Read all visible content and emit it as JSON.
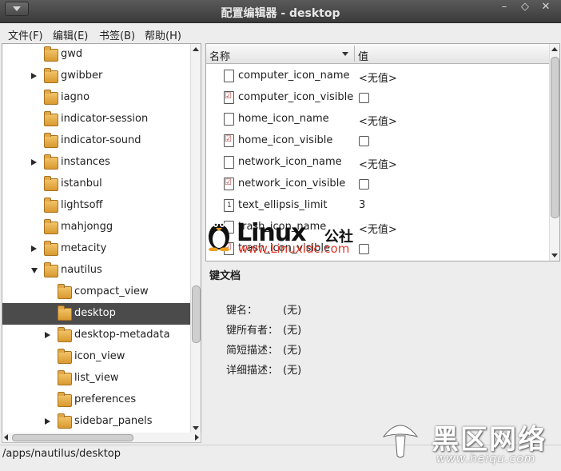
{
  "window": {
    "title": "配置编辑器 - desktop",
    "controls": [
      "–",
      "◇",
      "✕"
    ]
  },
  "menubar": [
    "文件(F)",
    "编辑(E)",
    "书签(B)",
    "帮助(H)"
  ],
  "tree": [
    {
      "label": "gwd",
      "depth": 0,
      "expander": "none",
      "selected": false
    },
    {
      "label": "gwibber",
      "depth": 0,
      "expander": "collapsed",
      "selected": false
    },
    {
      "label": "iagno",
      "depth": 0,
      "expander": "none",
      "selected": false
    },
    {
      "label": "indicator-session",
      "depth": 0,
      "expander": "none",
      "selected": false
    },
    {
      "label": "indicator-sound",
      "depth": 0,
      "expander": "none",
      "selected": false
    },
    {
      "label": "instances",
      "depth": 0,
      "expander": "collapsed",
      "selected": false
    },
    {
      "label": "istanbul",
      "depth": 0,
      "expander": "none",
      "selected": false
    },
    {
      "label": "lightsoff",
      "depth": 0,
      "expander": "none",
      "selected": false
    },
    {
      "label": "mahjongg",
      "depth": 0,
      "expander": "none",
      "selected": false
    },
    {
      "label": "metacity",
      "depth": 0,
      "expander": "collapsed",
      "selected": false
    },
    {
      "label": "nautilus",
      "depth": 0,
      "expander": "expanded",
      "selected": false
    },
    {
      "label": "compact_view",
      "depth": 1,
      "expander": "none",
      "selected": false
    },
    {
      "label": "desktop",
      "depth": 1,
      "expander": "none",
      "selected": true
    },
    {
      "label": "desktop-metadata",
      "depth": 1,
      "expander": "collapsed",
      "selected": false
    },
    {
      "label": "icon_view",
      "depth": 1,
      "expander": "none",
      "selected": false
    },
    {
      "label": "list_view",
      "depth": 1,
      "expander": "none",
      "selected": false
    },
    {
      "label": "preferences",
      "depth": 1,
      "expander": "none",
      "selected": false
    },
    {
      "label": "sidebar_panels",
      "depth": 1,
      "expander": "collapsed",
      "selected": false
    }
  ],
  "key_list": {
    "columns": [
      "名称",
      "值"
    ],
    "rows": [
      {
        "name": "computer_icon_name",
        "type": "string",
        "value": "<无值>"
      },
      {
        "name": "computer_icon_visible",
        "type": "bool",
        "value": ""
      },
      {
        "name": "home_icon_name",
        "type": "string",
        "value": "<无值>"
      },
      {
        "name": "home_icon_visible",
        "type": "bool",
        "value": ""
      },
      {
        "name": "network_icon_name",
        "type": "string",
        "value": "<无值>"
      },
      {
        "name": "network_icon_visible",
        "type": "bool",
        "value": ""
      },
      {
        "name": "text_ellipsis_limit",
        "type": "int",
        "value": "3"
      },
      {
        "name": "trash_icon_name",
        "type": "string",
        "value": "<无值>"
      },
      {
        "name": "trash_icon_visible",
        "type": "bool",
        "value": ""
      }
    ]
  },
  "doc": {
    "title": "键文档",
    "fields": [
      {
        "label": "键名：",
        "value": "(无)"
      },
      {
        "label": "键所有者：",
        "value": "(无)"
      },
      {
        "label": "简短描述：",
        "value": "(无)"
      },
      {
        "label": "详细描述：",
        "value": "(无)"
      }
    ]
  },
  "status_path": "/apps/nautilus/desktop",
  "watermarks": {
    "linux_word": "Linux",
    "linux_suffix": "公社",
    "linux_url": "www.Linuxidc.com",
    "heiqu_cn": "黑区网络",
    "heiqu_url": "www.heiqu.com"
  }
}
